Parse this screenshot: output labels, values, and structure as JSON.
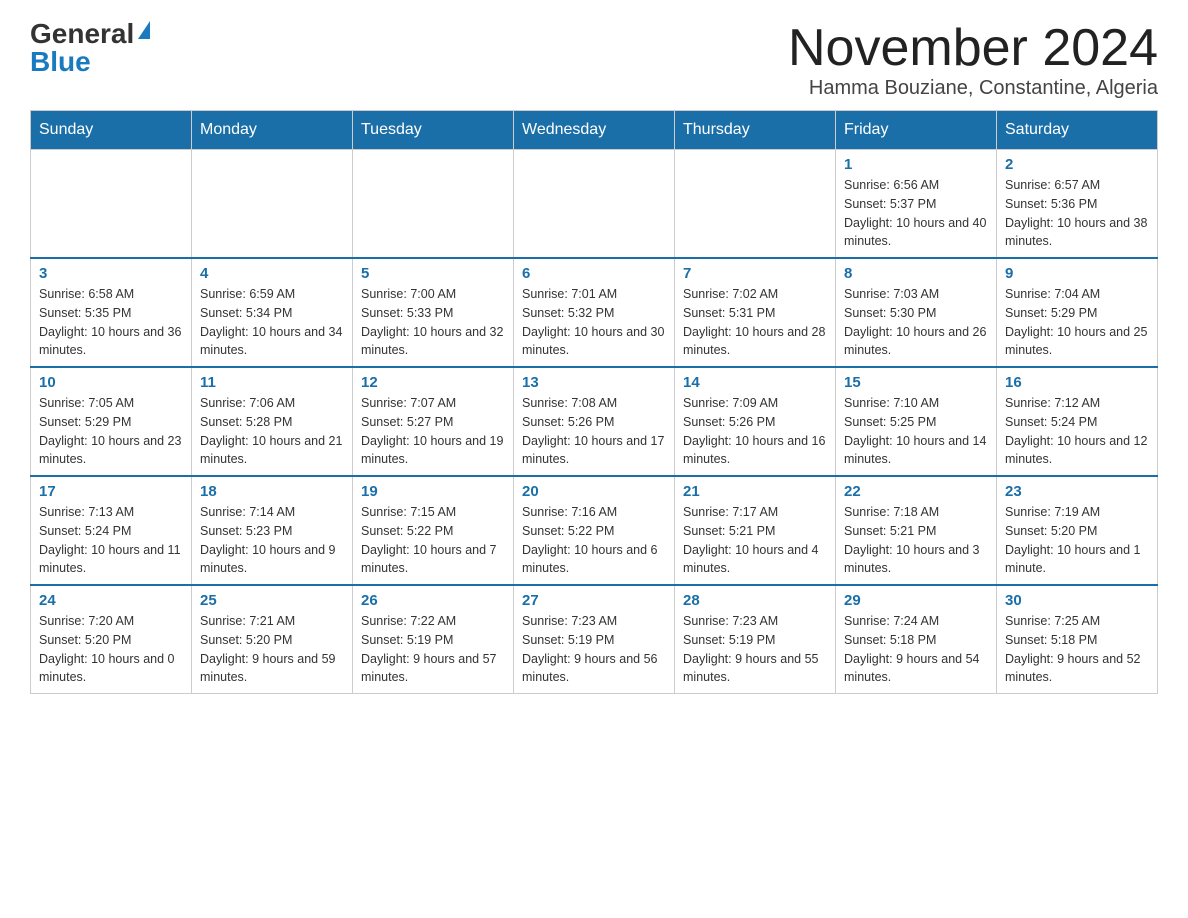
{
  "logo": {
    "general": "General",
    "blue": "Blue"
  },
  "header": {
    "month_year": "November 2024",
    "location": "Hamma Bouziane, Constantine, Algeria"
  },
  "weekdays": [
    "Sunday",
    "Monday",
    "Tuesday",
    "Wednesday",
    "Thursday",
    "Friday",
    "Saturday"
  ],
  "weeks": [
    [
      {
        "day": "",
        "sunrise": "",
        "sunset": "",
        "daylight": ""
      },
      {
        "day": "",
        "sunrise": "",
        "sunset": "",
        "daylight": ""
      },
      {
        "day": "",
        "sunrise": "",
        "sunset": "",
        "daylight": ""
      },
      {
        "day": "",
        "sunrise": "",
        "sunset": "",
        "daylight": ""
      },
      {
        "day": "",
        "sunrise": "",
        "sunset": "",
        "daylight": ""
      },
      {
        "day": "1",
        "sunrise": "Sunrise: 6:56 AM",
        "sunset": "Sunset: 5:37 PM",
        "daylight": "Daylight: 10 hours and 40 minutes."
      },
      {
        "day": "2",
        "sunrise": "Sunrise: 6:57 AM",
        "sunset": "Sunset: 5:36 PM",
        "daylight": "Daylight: 10 hours and 38 minutes."
      }
    ],
    [
      {
        "day": "3",
        "sunrise": "Sunrise: 6:58 AM",
        "sunset": "Sunset: 5:35 PM",
        "daylight": "Daylight: 10 hours and 36 minutes."
      },
      {
        "day": "4",
        "sunrise": "Sunrise: 6:59 AM",
        "sunset": "Sunset: 5:34 PM",
        "daylight": "Daylight: 10 hours and 34 minutes."
      },
      {
        "day": "5",
        "sunrise": "Sunrise: 7:00 AM",
        "sunset": "Sunset: 5:33 PM",
        "daylight": "Daylight: 10 hours and 32 minutes."
      },
      {
        "day": "6",
        "sunrise": "Sunrise: 7:01 AM",
        "sunset": "Sunset: 5:32 PM",
        "daylight": "Daylight: 10 hours and 30 minutes."
      },
      {
        "day": "7",
        "sunrise": "Sunrise: 7:02 AM",
        "sunset": "Sunset: 5:31 PM",
        "daylight": "Daylight: 10 hours and 28 minutes."
      },
      {
        "day": "8",
        "sunrise": "Sunrise: 7:03 AM",
        "sunset": "Sunset: 5:30 PM",
        "daylight": "Daylight: 10 hours and 26 minutes."
      },
      {
        "day": "9",
        "sunrise": "Sunrise: 7:04 AM",
        "sunset": "Sunset: 5:29 PM",
        "daylight": "Daylight: 10 hours and 25 minutes."
      }
    ],
    [
      {
        "day": "10",
        "sunrise": "Sunrise: 7:05 AM",
        "sunset": "Sunset: 5:29 PM",
        "daylight": "Daylight: 10 hours and 23 minutes."
      },
      {
        "day": "11",
        "sunrise": "Sunrise: 7:06 AM",
        "sunset": "Sunset: 5:28 PM",
        "daylight": "Daylight: 10 hours and 21 minutes."
      },
      {
        "day": "12",
        "sunrise": "Sunrise: 7:07 AM",
        "sunset": "Sunset: 5:27 PM",
        "daylight": "Daylight: 10 hours and 19 minutes."
      },
      {
        "day": "13",
        "sunrise": "Sunrise: 7:08 AM",
        "sunset": "Sunset: 5:26 PM",
        "daylight": "Daylight: 10 hours and 17 minutes."
      },
      {
        "day": "14",
        "sunrise": "Sunrise: 7:09 AM",
        "sunset": "Sunset: 5:26 PM",
        "daylight": "Daylight: 10 hours and 16 minutes."
      },
      {
        "day": "15",
        "sunrise": "Sunrise: 7:10 AM",
        "sunset": "Sunset: 5:25 PM",
        "daylight": "Daylight: 10 hours and 14 minutes."
      },
      {
        "day": "16",
        "sunrise": "Sunrise: 7:12 AM",
        "sunset": "Sunset: 5:24 PM",
        "daylight": "Daylight: 10 hours and 12 minutes."
      }
    ],
    [
      {
        "day": "17",
        "sunrise": "Sunrise: 7:13 AM",
        "sunset": "Sunset: 5:24 PM",
        "daylight": "Daylight: 10 hours and 11 minutes."
      },
      {
        "day": "18",
        "sunrise": "Sunrise: 7:14 AM",
        "sunset": "Sunset: 5:23 PM",
        "daylight": "Daylight: 10 hours and 9 minutes."
      },
      {
        "day": "19",
        "sunrise": "Sunrise: 7:15 AM",
        "sunset": "Sunset: 5:22 PM",
        "daylight": "Daylight: 10 hours and 7 minutes."
      },
      {
        "day": "20",
        "sunrise": "Sunrise: 7:16 AM",
        "sunset": "Sunset: 5:22 PM",
        "daylight": "Daylight: 10 hours and 6 minutes."
      },
      {
        "day": "21",
        "sunrise": "Sunrise: 7:17 AM",
        "sunset": "Sunset: 5:21 PM",
        "daylight": "Daylight: 10 hours and 4 minutes."
      },
      {
        "day": "22",
        "sunrise": "Sunrise: 7:18 AM",
        "sunset": "Sunset: 5:21 PM",
        "daylight": "Daylight: 10 hours and 3 minutes."
      },
      {
        "day": "23",
        "sunrise": "Sunrise: 7:19 AM",
        "sunset": "Sunset: 5:20 PM",
        "daylight": "Daylight: 10 hours and 1 minute."
      }
    ],
    [
      {
        "day": "24",
        "sunrise": "Sunrise: 7:20 AM",
        "sunset": "Sunset: 5:20 PM",
        "daylight": "Daylight: 10 hours and 0 minutes."
      },
      {
        "day": "25",
        "sunrise": "Sunrise: 7:21 AM",
        "sunset": "Sunset: 5:20 PM",
        "daylight": "Daylight: 9 hours and 59 minutes."
      },
      {
        "day": "26",
        "sunrise": "Sunrise: 7:22 AM",
        "sunset": "Sunset: 5:19 PM",
        "daylight": "Daylight: 9 hours and 57 minutes."
      },
      {
        "day": "27",
        "sunrise": "Sunrise: 7:23 AM",
        "sunset": "Sunset: 5:19 PM",
        "daylight": "Daylight: 9 hours and 56 minutes."
      },
      {
        "day": "28",
        "sunrise": "Sunrise: 7:23 AM",
        "sunset": "Sunset: 5:19 PM",
        "daylight": "Daylight: 9 hours and 55 minutes."
      },
      {
        "day": "29",
        "sunrise": "Sunrise: 7:24 AM",
        "sunset": "Sunset: 5:18 PM",
        "daylight": "Daylight: 9 hours and 54 minutes."
      },
      {
        "day": "30",
        "sunrise": "Sunrise: 7:25 AM",
        "sunset": "Sunset: 5:18 PM",
        "daylight": "Daylight: 9 hours and 52 minutes."
      }
    ]
  ]
}
